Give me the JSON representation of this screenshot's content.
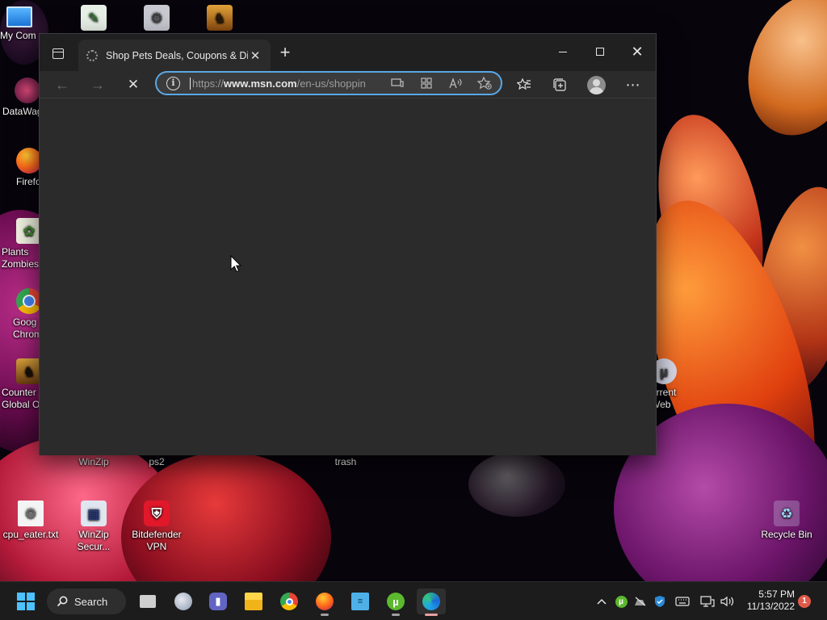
{
  "desktop": {
    "icons": [
      {
        "label": "My Com",
        "icon": "this-pc-icon"
      },
      {
        "label": "",
        "icon": "document-icon"
      },
      {
        "label": "",
        "icon": "tools-icon"
      },
      {
        "label": "",
        "icon": "game-icon"
      },
      {
        "label": "DataWag",
        "icon": "datawag-icon"
      },
      {
        "label": "Firefo",
        "icon": "firefox-icon"
      },
      {
        "label": "Plants Zombies",
        "icon": "plants-icon"
      },
      {
        "label": "Goog Chrom",
        "icon": "chrome-icon"
      },
      {
        "label": "Counter Global O",
        "icon": "counter-strike-icon"
      },
      {
        "label": "WinZip",
        "icon": "winzip-icon"
      },
      {
        "label": "ps2",
        "icon": "folder-icon"
      },
      {
        "label": "trash",
        "icon": "folder-icon"
      },
      {
        "label": "orrent Web",
        "icon": "utorrent-web-icon"
      },
      {
        "label": "cpu_eater.txt",
        "icon": "text-file-icon"
      },
      {
        "label": "WinZip Secur...",
        "icon": "winzip-secure-icon"
      },
      {
        "label": "Bitdefender VPN",
        "icon": "bitdefender-vpn-icon"
      },
      {
        "label": "Recycle Bin",
        "icon": "recycle-bin-icon"
      }
    ]
  },
  "browser": {
    "tab": {
      "title": "Shop Pets Deals, Coupons & Disc",
      "icon": "loading-spinner-icon",
      "close": "✕"
    },
    "new_tab": "+",
    "window_controls": {
      "minimize": "minimize",
      "maximize": "maximize",
      "close": "✕"
    },
    "nav": {
      "back": "←",
      "forward": "→",
      "stop": "✕"
    },
    "address": {
      "scheme": "https://",
      "host": "www.msn.com",
      "path": "/en-us/shoppin",
      "info_icon": "i"
    },
    "address_icons": [
      "app-available-icon",
      "extensions-grid-icon",
      "read-aloud-icon",
      "add-favorite-icon"
    ],
    "toolbar_icons": [
      "favorites-icon",
      "collections-icon",
      "profile-icon",
      "more-icon"
    ],
    "more": "⋯"
  },
  "taskbar": {
    "search_label": "Search",
    "apps": [
      "start-icon",
      "task-view-icon",
      "widgets-icon",
      "teams-chat-icon",
      "file-explorer-icon",
      "chrome-icon",
      "firefox-icon",
      "notepad-icon",
      "utorrent-icon",
      "edge-icon"
    ],
    "tray_icons": [
      "chevron-up-icon",
      "utorrent-tray-icon",
      "network-off-icon",
      "defender-icon",
      "keyboard-icon",
      "display-icon",
      "volume-icon"
    ],
    "clock": {
      "time": "5:57 PM",
      "date": "11/13/2022"
    },
    "notification_count": "1"
  },
  "colors": {
    "accent": "#5aa8e6",
    "browser_bg": "#2b2b2b",
    "titlebar_bg": "#202020",
    "taskbar_bg": "#1c1c1c"
  }
}
